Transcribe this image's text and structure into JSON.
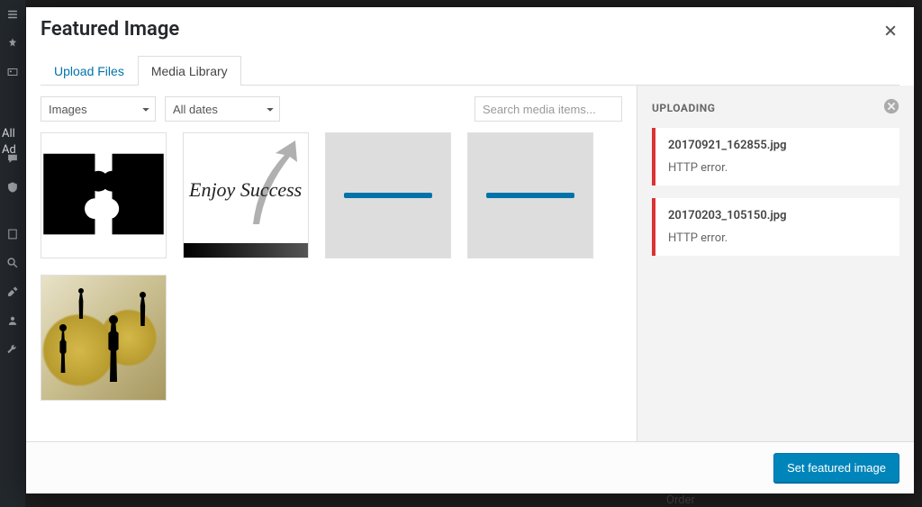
{
  "modal": {
    "title": "Featured Image",
    "close_label": "Close",
    "tabs": [
      {
        "label": "Upload Files",
        "active": false
      },
      {
        "label": "Media Library",
        "active": true
      }
    ]
  },
  "filters": {
    "type_value": "Images",
    "dates_value": "All dates"
  },
  "search": {
    "placeholder": "Search media items..."
  },
  "thumbs": {
    "success_text": "Enjoy Success"
  },
  "side_panel": {
    "heading": "UPLOADING",
    "dismiss_label": "Dismiss",
    "uploads": [
      {
        "filename": "20170921_162855.jpg",
        "error": "HTTP error."
      },
      {
        "filename": "20170203_105150.jpg",
        "error": "HTTP error."
      }
    ]
  },
  "footer": {
    "primary_label": "Set featured image"
  },
  "bg": {
    "all_text": "All",
    "add_text": "Ad",
    "order_text": "Order"
  }
}
